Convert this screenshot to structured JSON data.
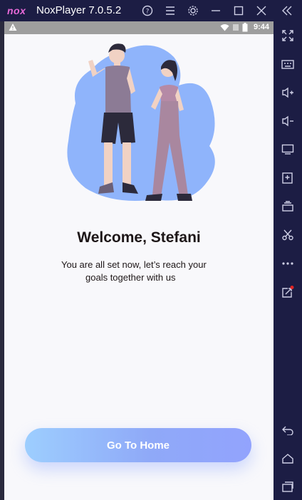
{
  "window": {
    "logo": "nox",
    "title": "NoxPlayer 7.0.5.2",
    "controls": [
      "help-icon",
      "menu-icon",
      "settings-icon",
      "minimize-icon",
      "maximize-icon",
      "close-icon",
      "collapse-icon"
    ]
  },
  "statusbar": {
    "time": "9:44"
  },
  "onboarding": {
    "welcome": "Welcome, Stefani",
    "subtitle_line1": "You are all set now, let’s reach your",
    "subtitle_line2": "goals together with us",
    "button_label": "Go To Home"
  },
  "colors": {
    "accent_blue": "#92a3fd",
    "accent_light": "#9dcefe",
    "blob": "#8fb4fb",
    "frame": "#1c1d44"
  },
  "sidebar_icons": [
    "fullscreen-icon",
    "keyboard-icon",
    "volume-up-icon",
    "volume-down-icon",
    "screen-icon",
    "apk-install-icon",
    "multi-instance-icon",
    "scissors-icon",
    "more-icon",
    "share-icon",
    "back-icon",
    "home-icon",
    "recents-icon"
  ]
}
